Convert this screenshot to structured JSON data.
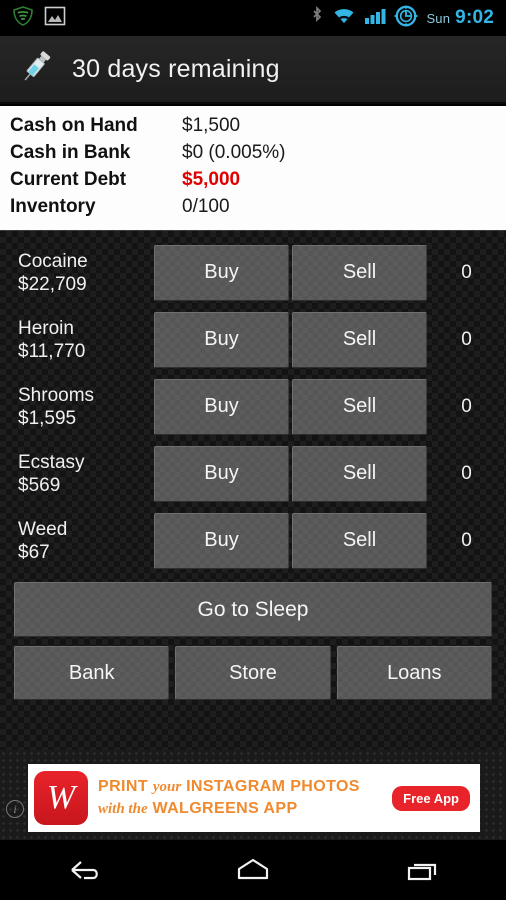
{
  "status_bar": {
    "left_icons": [
      "shield-green-icon",
      "screenshot-image-icon"
    ],
    "right_icons": [
      "bluetooth-icon",
      "wifi-icon",
      "signal-bars-icon",
      "battery-gear-icon"
    ],
    "day": "Sun",
    "time": "9:02",
    "accent_color": "#33b5e5"
  },
  "action_bar": {
    "icon": "syringe-icon",
    "title": "30 days remaining"
  },
  "stats": {
    "rows": [
      {
        "label": "Cash on Hand",
        "value": "$1,500",
        "highlight": false
      },
      {
        "label": "Cash in Bank",
        "value": "$0 (0.005%)",
        "highlight": false
      },
      {
        "label": "Current Debt",
        "value": "$5,000",
        "highlight": true
      },
      {
        "label": "Inventory",
        "value": "0/100",
        "highlight": false
      }
    ],
    "debt_color": "#e00000"
  },
  "drugs": {
    "buy_label": "Buy",
    "sell_label": "Sell",
    "rows": [
      {
        "name": "Cocaine",
        "price": "$22,709",
        "qty": "0"
      },
      {
        "name": "Heroin",
        "price": "$11,770",
        "qty": "0"
      },
      {
        "name": "Shrooms",
        "price": "$1,595",
        "qty": "0"
      },
      {
        "name": "Ecstasy",
        "price": "$569",
        "qty": "0"
      },
      {
        "name": "Weed",
        "price": "$67",
        "qty": "0"
      }
    ]
  },
  "actions": {
    "sleep_label": "Go to Sleep",
    "bank_label": "Bank",
    "store_label": "Store",
    "loans_label": "Loans"
  },
  "ad": {
    "info_glyph": "i",
    "logo_letter": "W",
    "line1_bold_a": "PRINT",
    "line1_script": "your",
    "line1_bold_b": "INSTAGRAM PHOTOS",
    "line2_script": "with the",
    "line2_bold": "WALGREENS APP",
    "badge_label": "Free App",
    "brand_color": "#e8232a",
    "text_color": "#f08a2e"
  },
  "nav_bar": {
    "back_label": "back-icon",
    "home_label": "home-icon",
    "recents_label": "recents-icon"
  }
}
